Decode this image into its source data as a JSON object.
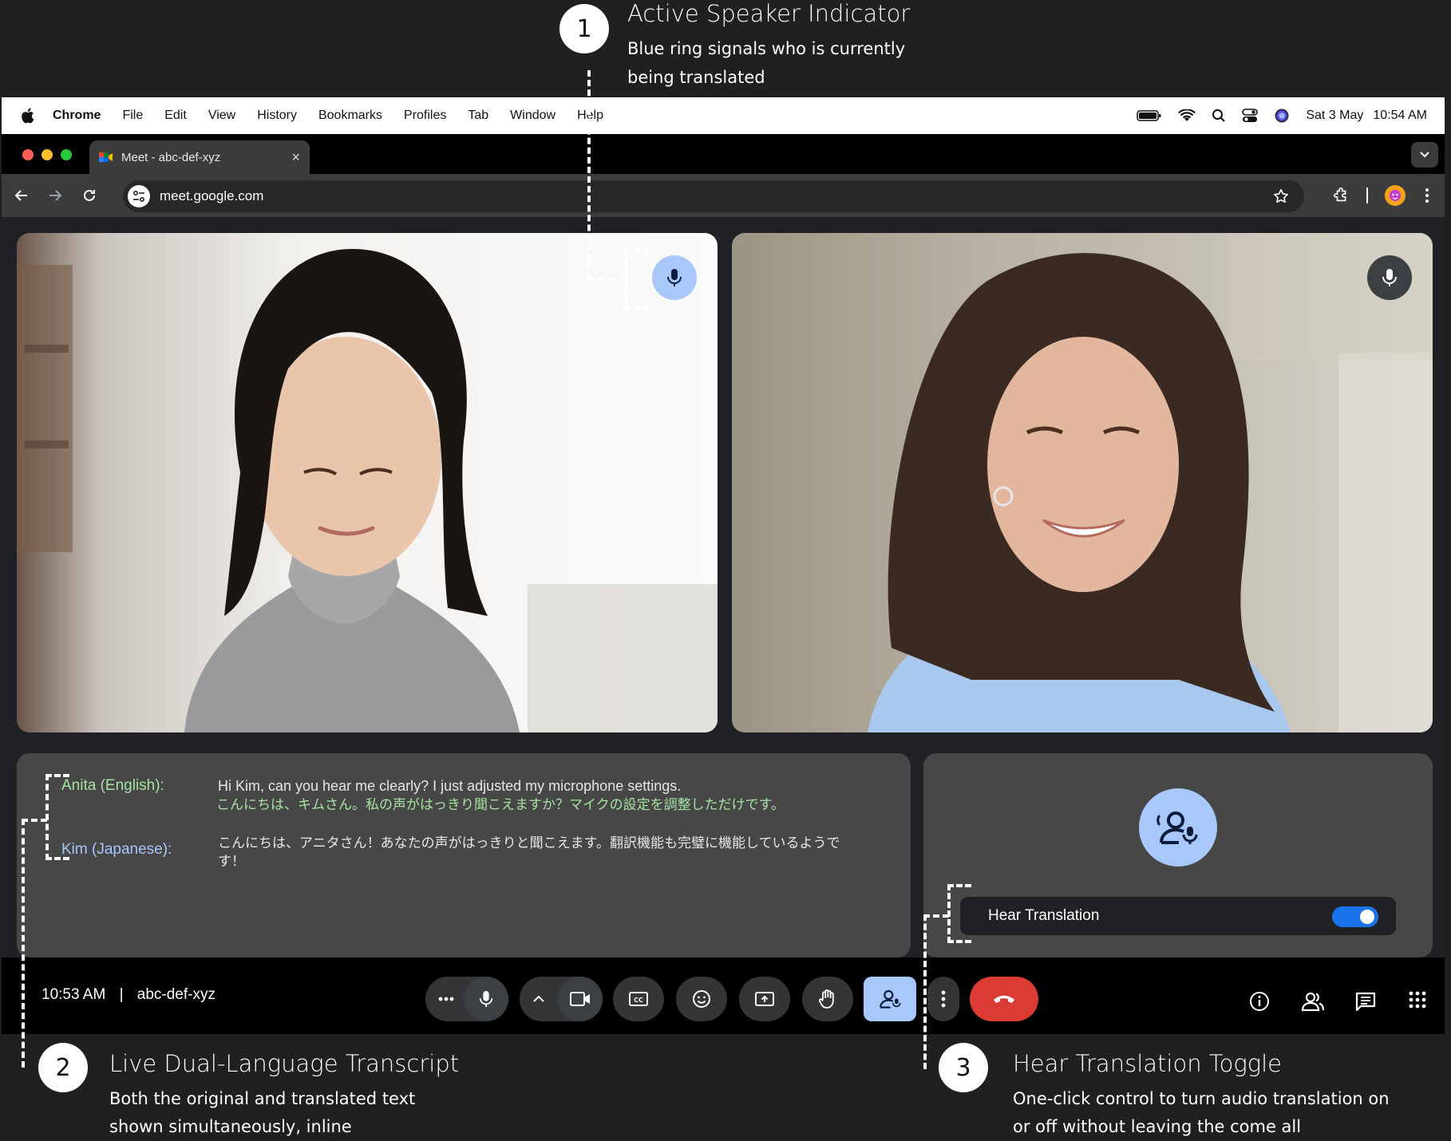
{
  "annotations": {
    "one": {
      "number": "1",
      "title": "Active Speaker Indicator",
      "desc_line1": "Blue ring signals who is currently",
      "desc_line2": "being translated"
    },
    "two": {
      "number": "2",
      "title": "Live Dual-Language Transcript",
      "desc_line1": "Both the original and translated text",
      "desc_line2": "shown simultaneously, inline"
    },
    "three": {
      "number": "3",
      "title": "Hear Translation Toggle",
      "desc_line1": "One-click control to turn audio translation on",
      "desc_line2": "or off without leaving the come all"
    }
  },
  "menubar": {
    "app": "Chrome",
    "items": [
      "File",
      "Edit",
      "View",
      "History",
      "Bookmarks",
      "Profiles",
      "Tab",
      "Window",
      "Help"
    ],
    "date": "Sat 3 May",
    "time": "10:54 AM"
  },
  "browser": {
    "tab_title": "Meet - abc-def-xyz",
    "tab_close": "×",
    "url": "meet.google.com"
  },
  "transcript": {
    "speaker1": {
      "label": "Anita (English):",
      "original": "Hi Kim, can you hear me clearly? I just adjusted my microphone settings.",
      "translated": "こんにちは、キムさん。私の声がはっきり聞こえますか？マイクの設定を調整しただけです。"
    },
    "speaker2": {
      "label": "Kim (Japanese):",
      "original": "こんにちは、アニタさん！あなたの声がはっきりと聞こえます。翻訳機能も完璧に機能しているようです！"
    }
  },
  "hear_panel": {
    "label": "Hear Translation",
    "enabled": true
  },
  "controlbar": {
    "time": "10:53 AM",
    "separator": "|",
    "code": "abc-def-xyz"
  },
  "colors": {
    "active_blue": "#a8c7fa",
    "toggle_blue": "#1a73e8",
    "end_call_red": "#dc3b33",
    "speaker1_green": "#a6e3a1",
    "speaker2_blue": "#a8c7fa"
  }
}
